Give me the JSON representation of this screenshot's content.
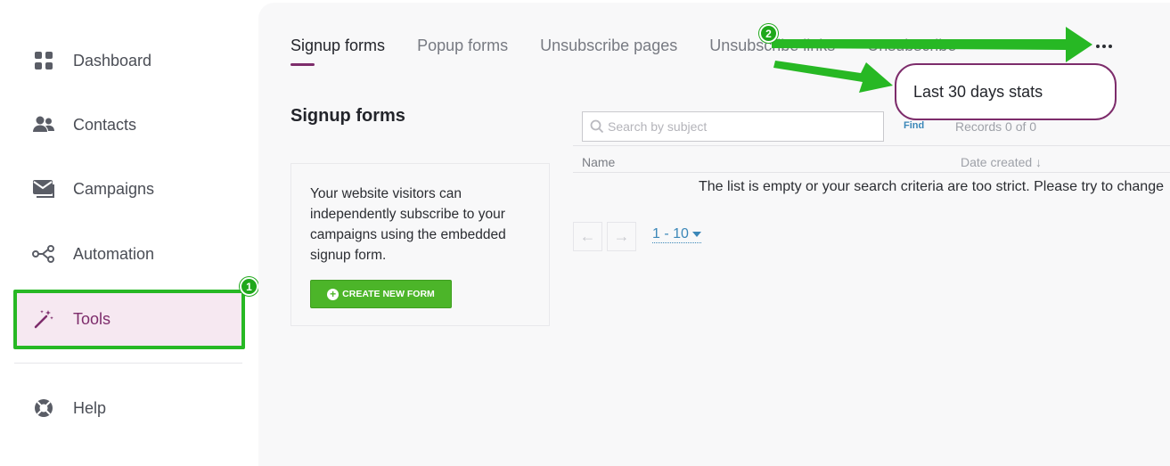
{
  "sidebar": {
    "items": [
      {
        "label": "Dashboard",
        "icon": "grid-icon"
      },
      {
        "label": "Contacts",
        "icon": "users-icon"
      },
      {
        "label": "Campaigns",
        "icon": "mail-icon"
      },
      {
        "label": "Automation",
        "icon": "share-icon"
      },
      {
        "label": "Tools",
        "icon": "magic-wand-icon",
        "active": true
      },
      {
        "label": "Help",
        "icon": "lifebuoy-icon"
      }
    ]
  },
  "tabs": [
    {
      "label": "Signup forms",
      "active": true
    },
    {
      "label": "Popup forms"
    },
    {
      "label": "Unsubscribe pages"
    },
    {
      "label": "Unsubscribe links"
    },
    {
      "label": "Unsubscribe"
    }
  ],
  "main": {
    "section_title": "Signup forms",
    "info_text": "Your website visitors can independently subscribe to your campaigns using the embedded signup form.",
    "create_button": "CREATE NEW FORM"
  },
  "table": {
    "search_placeholder": "Search by subject",
    "find_label": "Find",
    "records_text": "Records 0 of 0",
    "columns": {
      "name": "Name",
      "date_created": "Date created ↓"
    },
    "empty_message": "The list is empty or your search criteria are too strict. Please try to change",
    "page_range": "1 - 10"
  },
  "popup": {
    "label": "Last 30 days stats"
  },
  "annotations": {
    "step1": "1",
    "step2": "2"
  },
  "colors": {
    "accent": "#7d2c6b",
    "highlight": "#27b824",
    "link": "#3b87b8",
    "button": "#4cb529"
  }
}
